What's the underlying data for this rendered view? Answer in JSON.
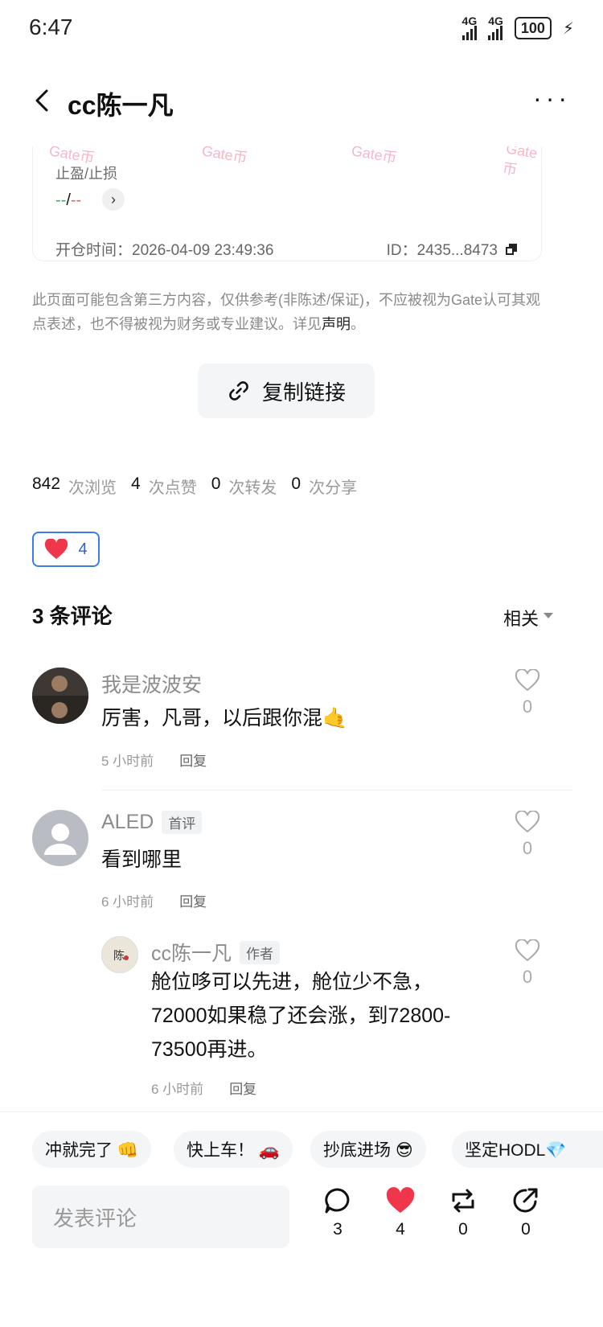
{
  "status": {
    "time": "6:47",
    "net1": "4G",
    "net2": "4G",
    "battery": "100"
  },
  "header": {
    "title": "cc陈一凡",
    "more": "···"
  },
  "card": {
    "watermark": "Gate币",
    "tp_label": "止盈/止损",
    "tp_value_left": "--",
    "tp_sep": "/",
    "tp_value_right": "--",
    "open_time": "开仓时间：2026-04-09 23:49:36",
    "position_id": "ID：2435...8473"
  },
  "disclaimer": {
    "text": "此页面可能包含第三方内容，仅供参考(非陈述/保证)，不应被视为Gate认可其观点表述，也不得被视为财务或专业建议。详见",
    "link": "声明",
    "end": "。"
  },
  "copy_link": {
    "label": "复制链接"
  },
  "stats": {
    "views": "842",
    "views_label": "次浏览",
    "likes": "4",
    "likes_label": "次点赞",
    "reposts": "0",
    "reposts_label": "次转发",
    "shares": "0",
    "shares_label": "次分享"
  },
  "like_chip": {
    "count": "4"
  },
  "comments": {
    "title": "3 条评论",
    "sort": "相关",
    "items": [
      {
        "name": "我是波波安",
        "text": "厉害，凡哥，以后跟你混🤙",
        "time": "5 小时前",
        "reply": "回复",
        "likes": "0"
      },
      {
        "name": "ALED",
        "badge": "首评",
        "text": "看到哪里",
        "time": "6 小时前",
        "reply": "回复",
        "likes": "0"
      },
      {
        "name": "cc陈一凡",
        "badge": "作者",
        "text": "舱位哆可以先进，舱位少不急，72000如果稳了还会涨，到72800-73500再进。",
        "time": "6 小时前",
        "reply": "回复",
        "likes": "0"
      }
    ]
  },
  "quick_replies": [
    "冲就完了 👊",
    "快上车！ 🚗",
    "抄底进场 😎",
    "坚定HODL💎"
  ],
  "bottom": {
    "placeholder": "发表评论",
    "comments": "3",
    "likes": "4",
    "reposts": "0",
    "shares": "0"
  },
  "colors": {
    "accent": "#3b7bea",
    "like_red": "#f0364a",
    "green": "#2fb36a",
    "red": "#d86a58"
  }
}
